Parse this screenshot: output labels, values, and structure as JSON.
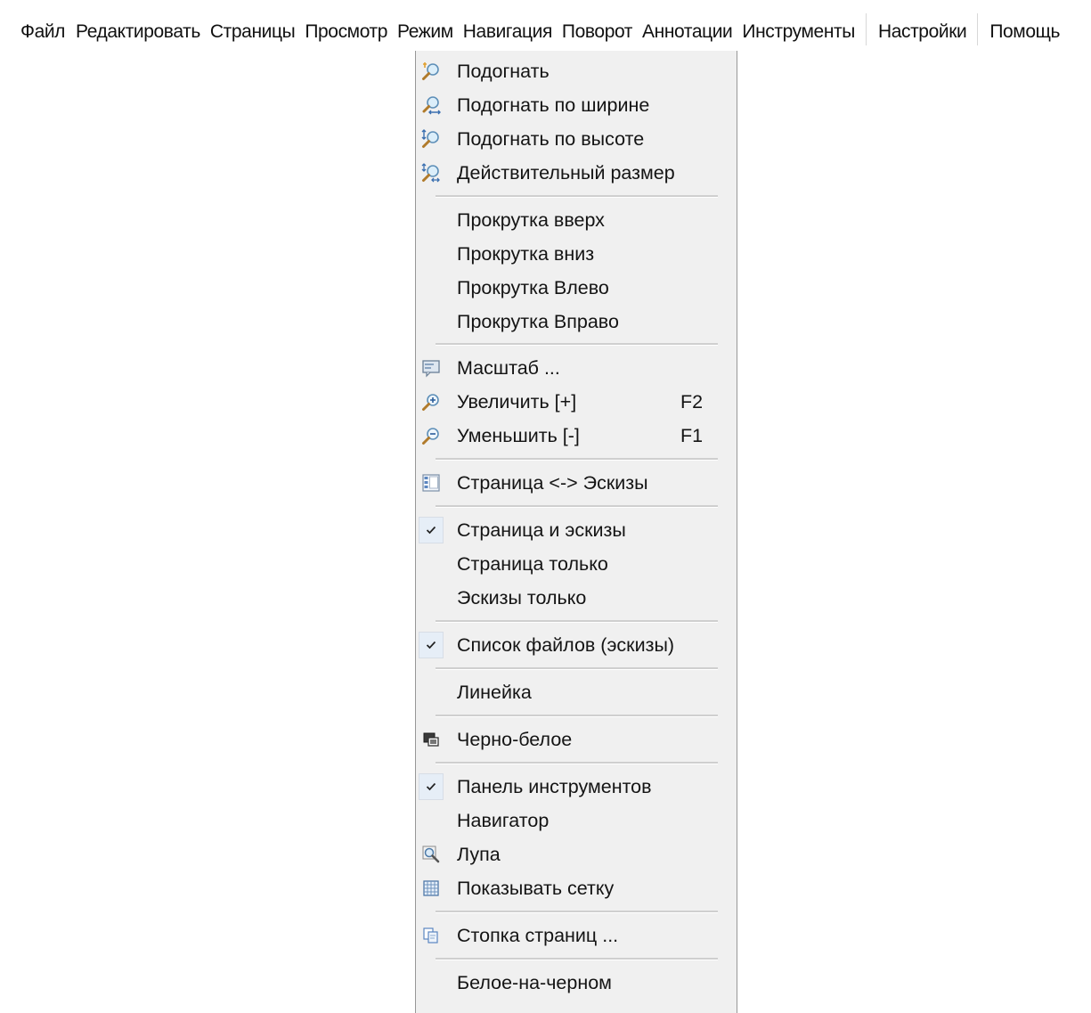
{
  "menubar": {
    "items": [
      {
        "label": "Файл"
      },
      {
        "label": "Редактировать"
      },
      {
        "label": "Страницы"
      },
      {
        "label": "Просмотр"
      },
      {
        "label": "Режим"
      },
      {
        "label": "Навигация"
      },
      {
        "label": "Поворот"
      },
      {
        "label": "Аннотации"
      },
      {
        "label": "Инструменты"
      },
      {
        "label": "Настройки"
      },
      {
        "label": "Помощь"
      }
    ]
  },
  "dropdown": {
    "items": [
      {
        "label": "Подогнать",
        "icon": "fit-zoom-icon"
      },
      {
        "label": "Подогнать по ширине",
        "icon": "fit-width-icon"
      },
      {
        "label": "Подогнать по высоте",
        "icon": "fit-height-icon"
      },
      {
        "label": "Действительный размер",
        "icon": "actual-size-icon"
      },
      {
        "label": "Прокрутка вверх"
      },
      {
        "label": "Прокрутка вниз"
      },
      {
        "label": "Прокрутка Влево"
      },
      {
        "label": "Прокрутка Вправо"
      },
      {
        "label": "Масштаб ...",
        "icon": "zoom-dialog-icon"
      },
      {
        "label": "Увеличить [+]",
        "shortcut": "F2",
        "icon": "zoom-in-icon"
      },
      {
        "label": "Уменьшить [-]",
        "shortcut": "F1",
        "icon": "zoom-out-icon"
      },
      {
        "label": "Страница <-> Эскизы",
        "icon": "page-thumbnails-icon"
      },
      {
        "label": "Страница и эскизы",
        "checked": true
      },
      {
        "label": "Страница только"
      },
      {
        "label": "Эскизы только"
      },
      {
        "label": "Список файлов (эскизы)",
        "checked": true
      },
      {
        "label": "Линейка"
      },
      {
        "label": "Черно-белое",
        "icon": "black-white-icon"
      },
      {
        "label": "Панель инструментов",
        "checked": true
      },
      {
        "label": "Навигатор"
      },
      {
        "label": "Лупа",
        "icon": "magnifier-icon"
      },
      {
        "label": "Показывать сетку",
        "icon": "grid-icon"
      },
      {
        "label": "Стопка страниц ...",
        "icon": "page-stack-icon"
      },
      {
        "label": "Белое-на-черном"
      }
    ]
  },
  "colors": {
    "menu_background": "#f0f0f0",
    "menu_border": "#979797",
    "separator": "#cfcfcf",
    "check_highlight": "#e6eef7"
  }
}
